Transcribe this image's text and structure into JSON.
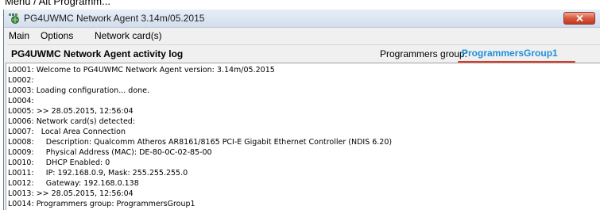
{
  "caption": "Menü / Alt Programm...",
  "window": {
    "title": "PG4UWMC Network Agent 3.14m/05.2015",
    "icon": "network-agent-app-icon",
    "close_icon": "close-icon"
  },
  "menu": {
    "items": [
      "Main",
      "Options",
      "Network card(s)"
    ]
  },
  "panel": {
    "title": "PG4UWMC Network Agent activity log",
    "group_label": "Programmers group:",
    "group_value": "ProgrammersGroup1",
    "group_value_color": "#1f8fd8",
    "underline_color": "#d43c2a"
  },
  "log": {
    "lines": [
      "L0001: Welcome to PG4UWMC Network Agent version: 3.14m/05.2015",
      "L0002:",
      "L0003: Loading configuration... done.",
      "L0004:",
      "L0005: >> 28.05.2015, 12:56:04",
      "L0006: Network card(s) detected:",
      "L0007:   Local Area Connection",
      "L0008:     Description: Qualcomm Atheros AR8161/8165 PCI-E Gigabit Ethernet Controller (NDIS 6.20)",
      "L0009:     Physical Address (MAC): DE-80-0C-02-85-00",
      "L0010:     DHCP Enabled: 0",
      "L0011:     IP: 192.168.0.9, Mask: 255.255.255.0",
      "L0012:     Gateway: 192.168.0.138",
      "L0013: >> 28.05.2015, 12:56:04",
      "L0014: Programmers group: ProgrammersGroup1"
    ]
  }
}
